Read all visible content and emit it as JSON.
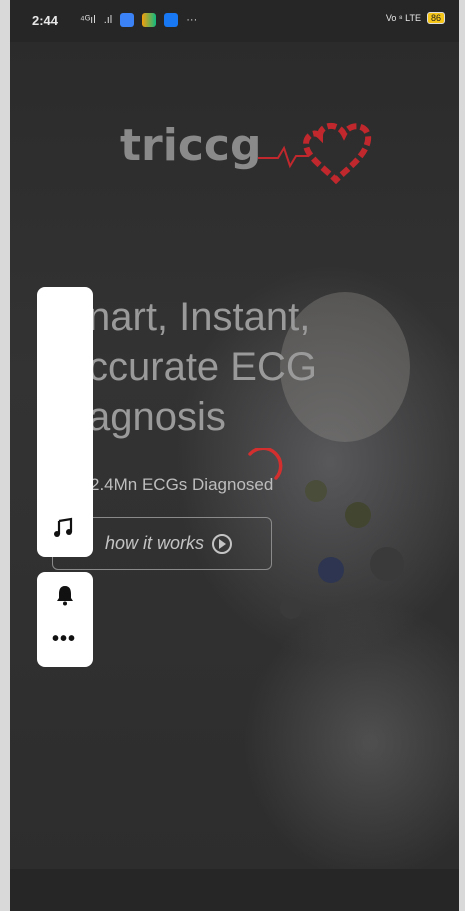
{
  "status_bar": {
    "time": "2:44",
    "signal_1": "⁴ᴳıl",
    "signal_2": ".ıl",
    "more": "···",
    "volte": "Vo ⁸ LTE",
    "battery": "86"
  },
  "hero": {
    "logo_text": "triccg",
    "headline_line1": "nart, Instant,",
    "headline_line2": "ccurate ECG",
    "headline_line3": "agnosis",
    "stat_text": "2.4Mn ECGs Diagnosed",
    "cta_label": "how it works"
  },
  "side_panel": {
    "icons": [
      "music-note-icon",
      "bell-icon",
      "more-icon"
    ]
  },
  "colors": {
    "accent_red": "#c0282d",
    "panel_white": "#ffffff",
    "overlay_dark": "#2a2a2a"
  }
}
